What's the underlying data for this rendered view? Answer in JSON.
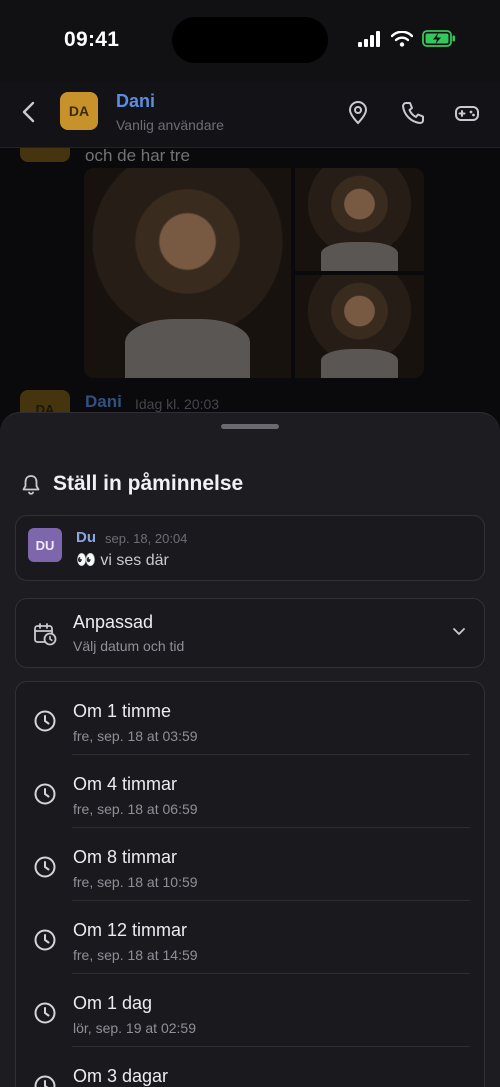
{
  "status_bar": {
    "time": "09:41"
  },
  "chat_header": {
    "avatar_initials": "DA",
    "name": "Dani",
    "subtitle": "Vanlig användare"
  },
  "chat": {
    "previous_message": "och de har tre",
    "next_sender": "Dani",
    "next_time": "Idag kl. 20:03",
    "next_avatar_initials": "DA"
  },
  "sheet": {
    "title": "Ställ in påminnelse",
    "quoted": {
      "avatar_initials": "DU",
      "author": "Du",
      "time": "sep. 18, 20:04",
      "text": "👀 vi ses där"
    },
    "custom": {
      "title": "Anpassad",
      "subtitle": "Välj datum och tid"
    },
    "options": [
      {
        "label": "Om 1 timme",
        "when": "fre, sep. 18 at 03:59"
      },
      {
        "label": "Om 4 timmar",
        "when": "fre, sep. 18 at 06:59"
      },
      {
        "label": "Om 8 timmar",
        "when": "fre, sep. 18 at 10:59"
      },
      {
        "label": "Om 12 timmar",
        "when": "fre, sep. 18 at 14:59"
      },
      {
        "label": "Om 1 dag",
        "when": "lör, sep. 19 at 02:59"
      },
      {
        "label": "Om 3 dagar",
        "when": ""
      }
    ]
  },
  "colors": {
    "accent_blue": "#5b8de0",
    "avatar_dani": "#c8922a",
    "avatar_du": "#7e66ad",
    "battery_green": "#34c759"
  },
  "icons": [
    "back-chevron-icon",
    "location-pin-icon",
    "phone-icon",
    "gamepad-icon",
    "bell-icon",
    "calendar-clock-icon",
    "chevron-down-icon",
    "clock-icon"
  ]
}
